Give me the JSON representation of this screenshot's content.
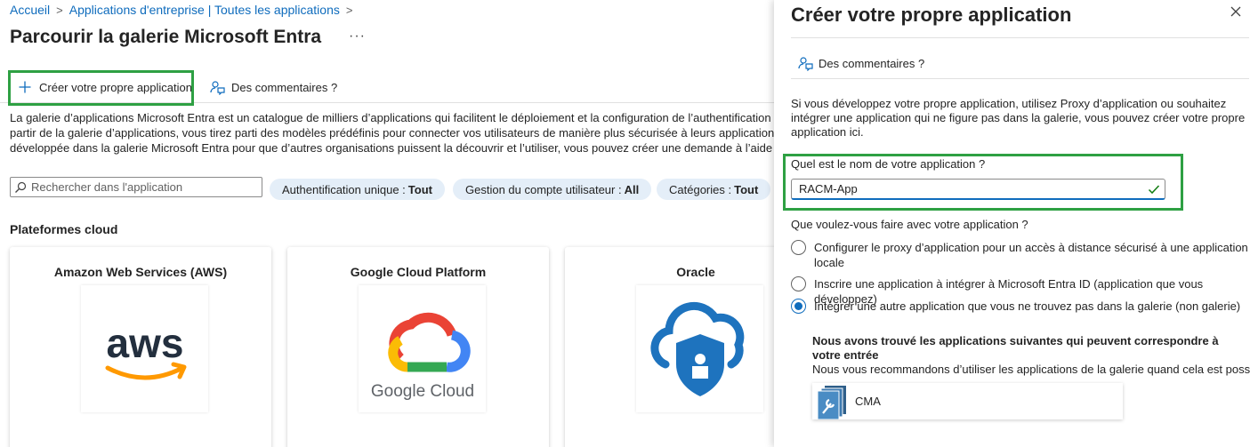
{
  "breadcrumb": {
    "home": "Accueil",
    "parent": "Applications d'entreprise | Toutes les applications",
    "sep": ">"
  },
  "page": {
    "title": "Parcourir la galerie Microsoft Entra",
    "more": "···"
  },
  "toolbar": {
    "create_label": "Créer votre propre application",
    "feedback_label": "Des commentaires ?"
  },
  "description": {
    "line1": "La galerie d’applications Microsoft Entra est un catalogue de milliers d’applications qui facilitent le déploiement et la configuration de l’authentification unique",
    "line2": "partir de la galerie d’applications, vous tirez parti des modèles prédéfinis pour connecter vos utilisateurs de manière plus sécurisée à leurs applications. Parcour",
    "line3": "développée dans la galerie Microsoft Entra pour que d’autres organisations puissent la découvrir et l’utiliser, vous pouvez créer une demande à l’aide du proces"
  },
  "filters": {
    "search_placeholder": "Rechercher dans l'application",
    "pills": [
      {
        "label": "Authentification unique :",
        "value": "Tout"
      },
      {
        "label": "Gestion du compte utilisateur :",
        "value": "All"
      },
      {
        "label": "Catégories :",
        "value": "Tout"
      }
    ]
  },
  "cloud": {
    "section_title": "Plateformes cloud",
    "cards": [
      {
        "title": "Amazon Web Services (AWS)",
        "logo_text": "aws"
      },
      {
        "title": "Google Cloud Platform",
        "logo_text": "Google Cloud"
      },
      {
        "title": "Oracle"
      }
    ]
  },
  "panel": {
    "title": "Créer votre propre application",
    "feedback_label": "Des commentaires ?",
    "intro": "Si vous développez votre propre application, utilisez Proxy d’application ou souhaitez intégrer une application qui ne figure pas dans la galerie, vous pouvez créer votre propre application ici.",
    "name_label": "Quel est le nom de votre application ?",
    "name_value": "RACM-App",
    "question": "Que voulez-vous faire avec votre application ?",
    "options": [
      {
        "label": "Configurer le proxy d’application pour un accès à distance sécurisé à une application locale",
        "checked": false
      },
      {
        "label": "Inscrire une application à intégrer à Microsoft Entra ID (application que vous développez)",
        "checked": false
      },
      {
        "label": "Intégrer une autre application que vous ne trouvez pas dans la galerie (non galerie)",
        "checked": true
      }
    ],
    "found_title": "Nous avons trouvé les applications suivantes qui peuvent correspondre à votre entrée",
    "found_sub": "Nous vous recommandons d’utiliser les applications de la galerie quand cela est possible.",
    "suggested_app": "CMA"
  },
  "colors": {
    "link": "#0f6cbd",
    "highlight": "#2ea043",
    "pill_bg": "#e4eef8",
    "aws_orange": "#ff9900",
    "aws_navy": "#232f3e",
    "oracle_blue": "#1e73be"
  }
}
